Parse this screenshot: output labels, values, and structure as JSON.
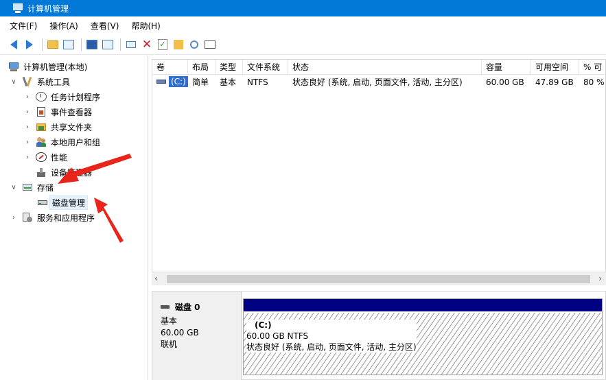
{
  "window": {
    "title": "计算机管理"
  },
  "menu": [
    "文件(F)",
    "操作(A)",
    "查看(V)",
    "帮助(H)"
  ],
  "tree": {
    "root": "计算机管理(本地)",
    "system_tools": "系统工具",
    "task_scheduler": "任务计划程序",
    "event_viewer": "事件查看器",
    "shared_folders": "共享文件夹",
    "local_users": "本地用户和组",
    "performance": "性能",
    "device_manager": "设备管理器",
    "storage": "存储",
    "disk_management": "磁盘管理",
    "services_apps": "服务和应用程序"
  },
  "volume_table": {
    "headers": [
      "卷",
      "布局",
      "类型",
      "文件系统",
      "状态",
      "容量",
      "可用空间",
      "% 可"
    ],
    "rows": [
      {
        "volume": "(C:)",
        "layout": "简单",
        "type": "基本",
        "fs": "NTFS",
        "status": "状态良好 (系统, 启动, 页面文件, 活动, 主分区)",
        "capacity": "60.00 GB",
        "free": "47.89 GB",
        "pct": "80 %"
      }
    ]
  },
  "disk": {
    "name": "磁盘 0",
    "kind": "基本",
    "size": "60.00 GB",
    "state": "联机",
    "partition": {
      "label": "(C:)",
      "size_fs": "60.00 GB NTFS",
      "status": "状态良好 (系统, 启动, 页面文件, 活动, 主分区)"
    }
  },
  "colors": {
    "titlebar": "#0078d7",
    "partition_bar": "#000082",
    "annotation": "#e8251b"
  }
}
